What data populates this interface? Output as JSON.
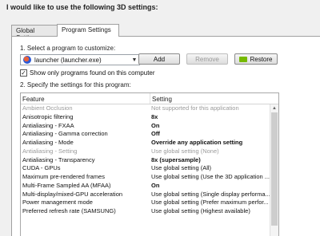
{
  "heading": "I would like to use the following 3D settings:",
  "tabs": [
    {
      "label": "Global Settings"
    },
    {
      "label": "Program Settings"
    }
  ],
  "step1": "1. Select a program to customize:",
  "program": {
    "selected": "launcher (launcher.exe)"
  },
  "buttons": {
    "add": "Add",
    "remove": "Remove",
    "restore": "Restore"
  },
  "show_only": {
    "label": "Show only programs found on this computer",
    "checked": true
  },
  "step2": "2. Specify the settings for this program:",
  "table": {
    "headers": {
      "feature": "Feature",
      "setting": "Setting"
    },
    "rows": [
      {
        "feature": "Ambient Occlusion",
        "setting": "Not supported for this application",
        "dim": true,
        "bold": false
      },
      {
        "feature": "Anisotropic filtering",
        "setting": "8x",
        "dim": false,
        "bold": true
      },
      {
        "feature": "Antialiasing - FXAA",
        "setting": "On",
        "dim": false,
        "bold": true
      },
      {
        "feature": "Antialiasing - Gamma correction",
        "setting": "Off",
        "dim": false,
        "bold": true
      },
      {
        "feature": "Antialiasing - Mode",
        "setting": "Override any application setting",
        "dim": false,
        "bold": true
      },
      {
        "feature": "Antialiasing - Setting",
        "setting": "Use global setting (None)",
        "dim": true,
        "bold": false
      },
      {
        "feature": "Antialiasing - Transparency",
        "setting": "8x (supersample)",
        "dim": false,
        "bold": true
      },
      {
        "feature": "CUDA - GPUs",
        "setting": "Use global setting (All)",
        "dim": false,
        "bold": false
      },
      {
        "feature": "Maximum pre-rendered frames",
        "setting": "Use global setting (Use the 3D application ...",
        "dim": false,
        "bold": false
      },
      {
        "feature": "Multi-Frame Sampled AA (MFAA)",
        "setting": "On",
        "dim": false,
        "bold": true
      },
      {
        "feature": "Multi-display/mixed-GPU acceleration",
        "setting": "Use global setting (Single display performa...",
        "dim": false,
        "bold": false
      },
      {
        "feature": "Power management mode",
        "setting": "Use global setting (Prefer maximum perfor...",
        "dim": false,
        "bold": false
      },
      {
        "feature": "Preferred refresh rate (SAMSUNG)",
        "setting": "Use global setting (Highest available)",
        "dim": false,
        "bold": false
      }
    ]
  }
}
